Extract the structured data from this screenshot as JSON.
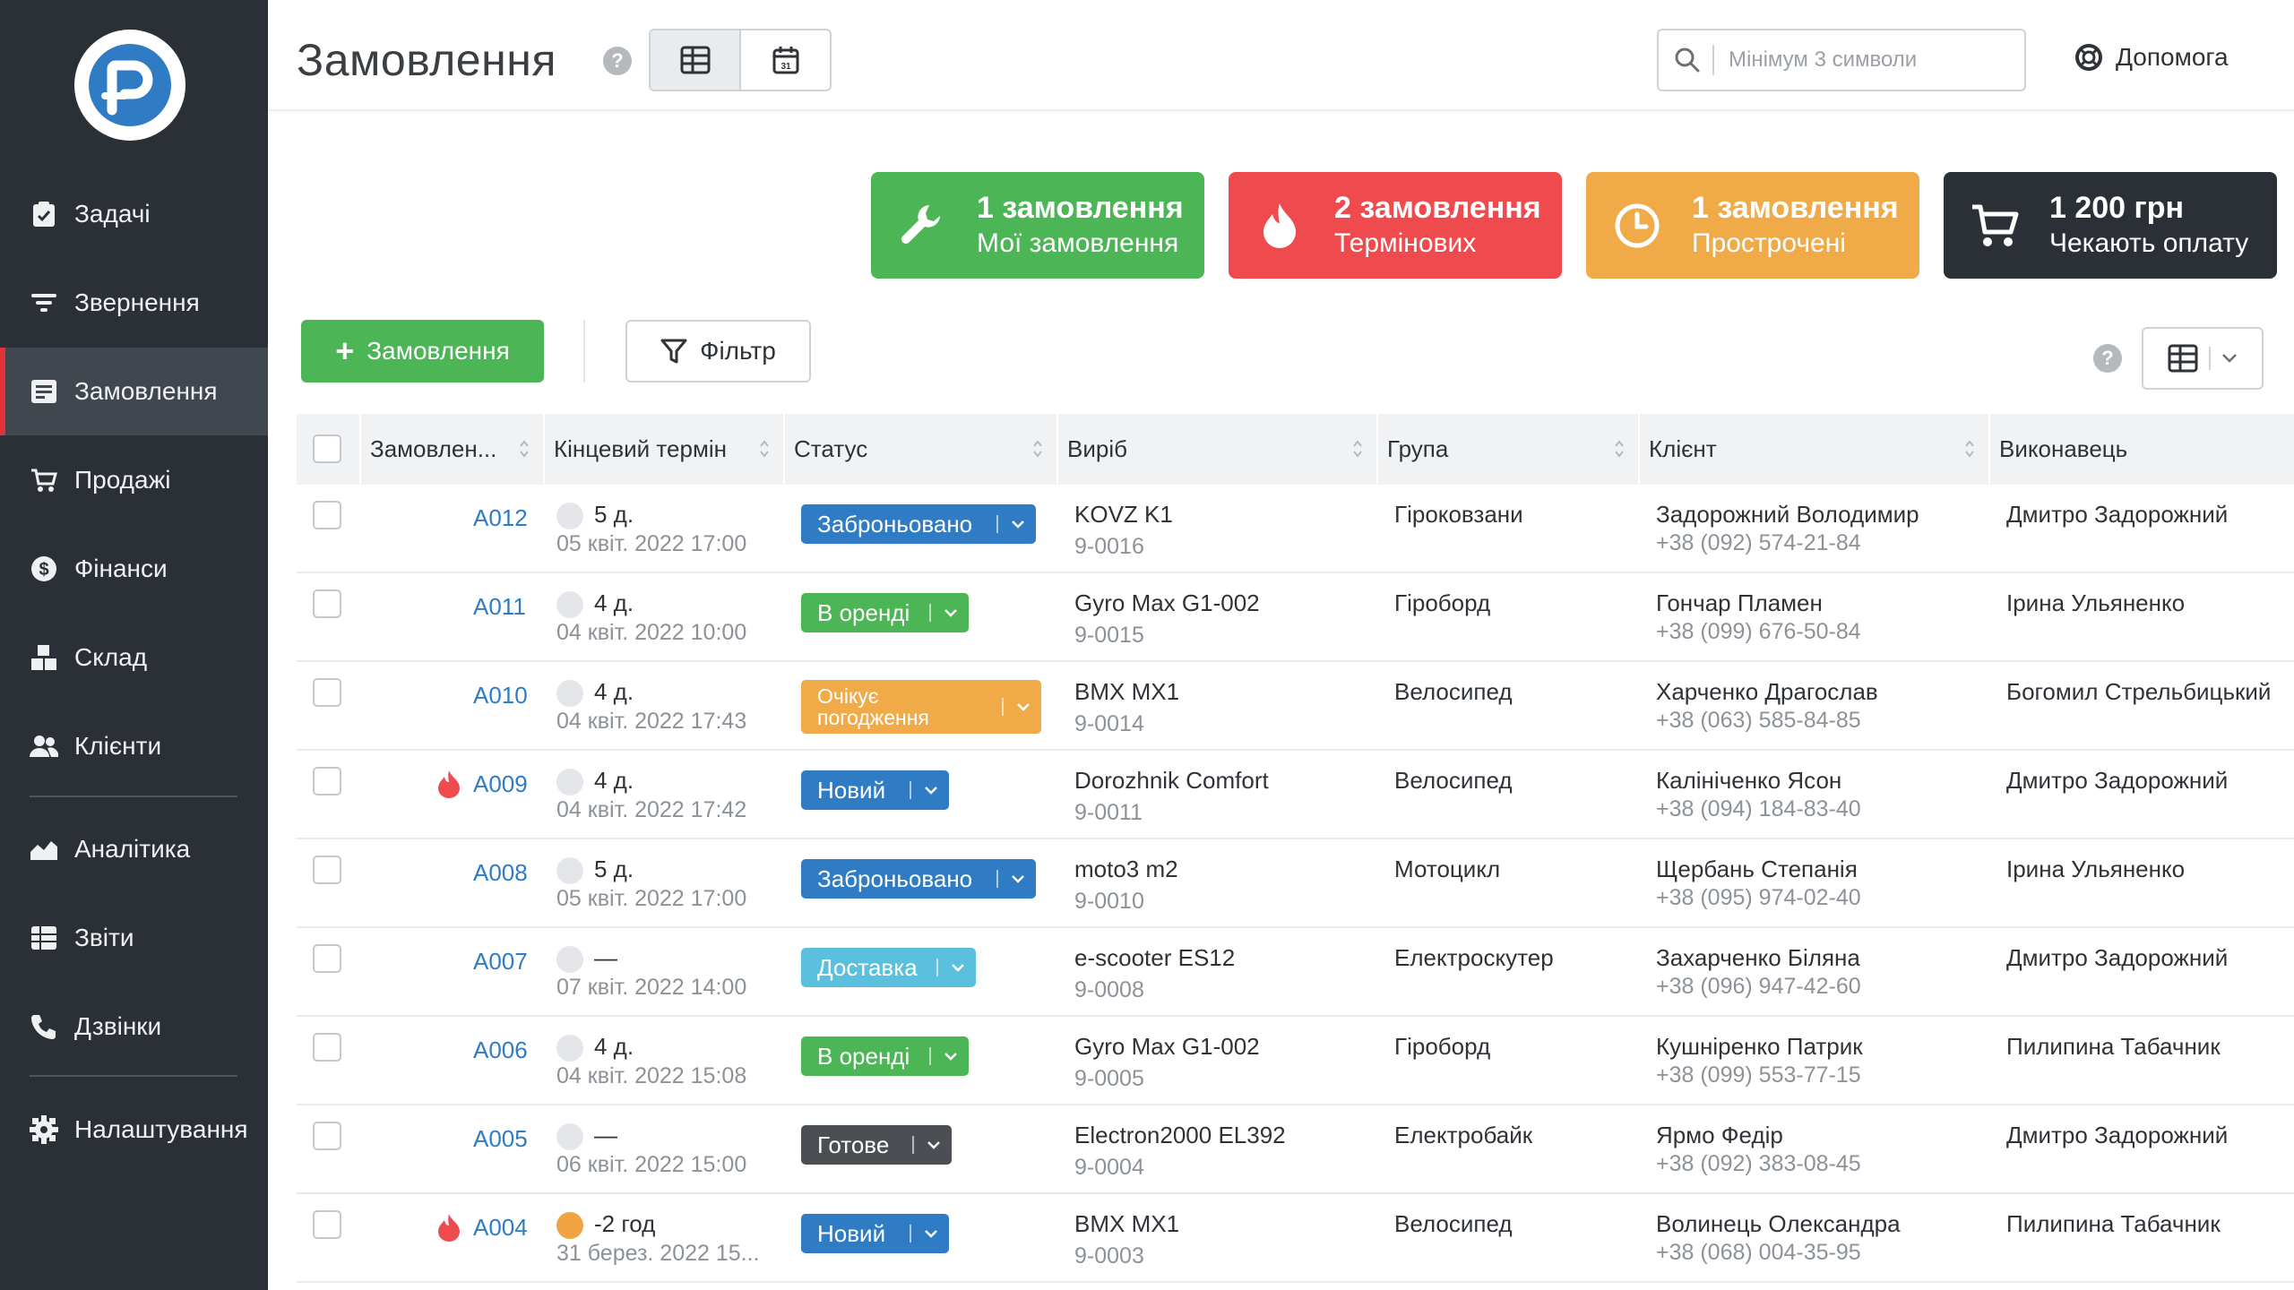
{
  "sidebar": {
    "items": [
      {
        "label": "Задачі",
        "icon": "clipboard-check-icon"
      },
      {
        "label": "Звернення",
        "icon": "filter-lines-icon"
      },
      {
        "label": "Замовлення",
        "icon": "order-list-icon",
        "active": true
      },
      {
        "label": "Продажі",
        "icon": "cart-icon"
      },
      {
        "label": "Фінанси",
        "icon": "dollar-coin-icon"
      },
      {
        "label": "Склад",
        "icon": "boxes-icon"
      },
      {
        "label": "Клієнти",
        "icon": "users-icon"
      },
      {
        "label": "Аналітика",
        "icon": "area-chart-icon"
      },
      {
        "label": "Звіти",
        "icon": "report-table-icon"
      },
      {
        "label": "Дзвінки",
        "icon": "phone-icon"
      },
      {
        "label": "Налаштування",
        "icon": "gear-icon"
      }
    ]
  },
  "header": {
    "title": "Замовлення",
    "help": "?",
    "search_placeholder": "Мінімум 3 символи",
    "help_label": "Допомога"
  },
  "cards": [
    {
      "title": "1 замовлення",
      "sub": "Мої замовлення",
      "color": "#4cb556",
      "icon": "wrench-icon"
    },
    {
      "title": "2 замовлення",
      "sub": "Термінових",
      "color": "#ef4b4f",
      "icon": "fire-icon"
    },
    {
      "title": "1 замовлення",
      "sub": "Прострочені",
      "color": "#f0ab48",
      "icon": "clock-icon"
    },
    {
      "title": "1 200 грн",
      "sub": "Чекають оплату",
      "color": "#2b3036",
      "icon": "cart-icon"
    }
  ],
  "toolbar": {
    "add_label": "Замовлення",
    "filter_label": "Фільтр"
  },
  "table": {
    "columns": [
      "Замовлен...",
      "Кінцевий термін",
      "Статус",
      "Виріб",
      "Група",
      "Клієнт",
      "Виконавець"
    ],
    "rows": [
      {
        "id": "A012",
        "urgent": false,
        "due": "5 д.",
        "date": "05 квіт. 2022 17:00",
        "status": "Заброньовано",
        "status_color": "#2f7cc4",
        "product": "KOVZ K1",
        "code": "9-0016",
        "group": "Гіроковзани",
        "client": "Задорожний Володимир",
        "phone": "+38 (092) 574-21-84",
        "assignee": "Дмитро Задорожний"
      },
      {
        "id": "A011",
        "urgent": false,
        "due": "4 д.",
        "date": "04 квіт. 2022 10:00",
        "status": "В оренді",
        "status_color": "#4cb556",
        "product": "Gyro Max G1-002",
        "code": "9-0015",
        "group": "Гіроборд",
        "client": "Гончар Пламен",
        "phone": "+38 (099) 676-50-84",
        "assignee": "Ірина Ульяненко"
      },
      {
        "id": "A010",
        "urgent": false,
        "due": "4 д.",
        "date": "04 квіт. 2022 17:43",
        "status": "Очікує погодження",
        "status_color": "#f0ab48",
        "product": "BMX MX1",
        "code": "9-0014",
        "group": "Велосипед",
        "client": "Харченко Драгослав",
        "phone": "+38 (063) 585-84-85",
        "assignee": "Богомил Стрельбицький"
      },
      {
        "id": "A009",
        "urgent": true,
        "due": "4 д.",
        "date": "04 квіт. 2022 17:42",
        "status": "Новий",
        "status_color": "#2f7cc4",
        "product": "Dorozhnik Comfort",
        "code": "9-0011",
        "group": "Велосипед",
        "client": "Калініченко Ясон",
        "phone": "+38 (094) 184-83-40",
        "assignee": "Дмитро Задорожний"
      },
      {
        "id": "A008",
        "urgent": false,
        "due": "5 д.",
        "date": "05 квіт. 2022 17:00",
        "status": "Заброньовано",
        "status_color": "#2f7cc4",
        "product": "moto3 m2",
        "code": "9-0010",
        "group": "Мотоцикл",
        "client": "Щербань Степанія",
        "phone": "+38 (095) 974-02-40",
        "assignee": "Ірина Ульяненко"
      },
      {
        "id": "A007",
        "urgent": false,
        "due": "—",
        "date": "07 квіт. 2022 14:00",
        "status": "Доставка",
        "status_color": "#5bc0de",
        "product": "e-scooter ES12",
        "code": "9-0008",
        "group": "Електроскутер",
        "client": "Захарченко Біляна",
        "phone": "+38 (096) 947-42-60",
        "assignee": "Дмитро Задорожний"
      },
      {
        "id": "A006",
        "urgent": false,
        "due": "4 д.",
        "date": "04 квіт. 2022 15:08",
        "status": "В оренді",
        "status_color": "#4cb556",
        "product": "Gyro Max G1-002",
        "code": "9-0005",
        "group": "Гіроборд",
        "client": "Кушніренко Патрик",
        "phone": "+38 (099) 553-77-15",
        "assignee": "Пилипина Табачник"
      },
      {
        "id": "A005",
        "urgent": false,
        "due": "—",
        "date": "06 квіт. 2022 15:00",
        "status": "Готове",
        "status_color": "#4b4f54",
        "product": "Electron2000 EL392",
        "code": "9-0004",
        "group": "Електробайк",
        "client": "Ярмо Федір",
        "phone": "+38 (092) 383-08-45",
        "assignee": "Дмитро Задорожний"
      },
      {
        "id": "A004",
        "urgent": true,
        "due": "-2 год",
        "date": "31 берез. 2022 15...",
        "status": "Новий",
        "status_color": "#2f7cc4",
        "product": "BMX MX1",
        "code": "9-0003",
        "group": "Велосипед",
        "client": "Волинець Олександра",
        "phone": "+38 (068) 004-35-95",
        "assignee": "Пилипина Табачник"
      }
    ]
  }
}
